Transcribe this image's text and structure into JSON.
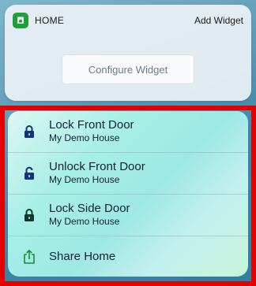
{
  "widget": {
    "app_name": "HOME",
    "add_widget_label": "Add Widget",
    "configure_label": "Configure Widget"
  },
  "actions": [
    {
      "title": "Lock Front Door",
      "subtitle": "My Demo House",
      "icon": "lock-closed-icon"
    },
    {
      "title": "Unlock Front Door",
      "subtitle": "My Demo House",
      "icon": "lock-open-icon"
    },
    {
      "title": "Lock Side Door",
      "subtitle": "My Demo House",
      "icon": "lock-closed-icon"
    }
  ],
  "share": {
    "label": "Share Home",
    "icon": "share-icon"
  },
  "colors": {
    "highlight_border": "#e30000",
    "home_app_green": "#1f9f3c",
    "lock_blue": "#14337a",
    "share_green": "#1e8a3a"
  }
}
